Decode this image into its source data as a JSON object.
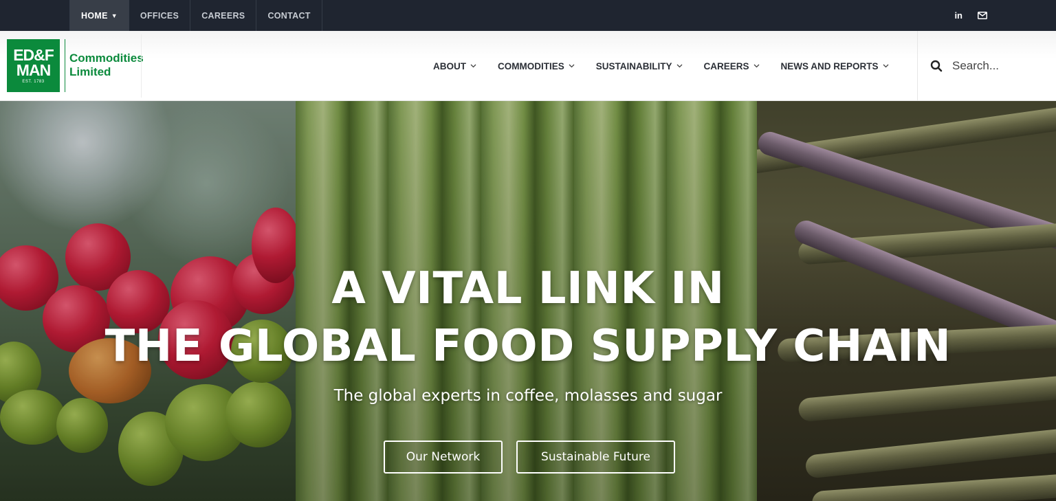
{
  "topbar": {
    "nav": [
      {
        "label": "HOME",
        "active": true,
        "has_dropdown": true
      },
      {
        "label": "OFFICES",
        "active": false
      },
      {
        "label": "CAREERS",
        "active": false
      },
      {
        "label": "CONTACT",
        "active": false
      }
    ],
    "icons": [
      "linkedin-icon",
      "email-icon"
    ],
    "linkedin_glyph": "in",
    "email_glyph": "✉"
  },
  "logo": {
    "line1": "ED&F",
    "line2": "MAN",
    "est": "EST. 1783",
    "name_line1": "Commodities",
    "name_line2": "Limited",
    "brand_color": "#0b8a3c"
  },
  "mainnav": {
    "items": [
      {
        "label": "ABOUT"
      },
      {
        "label": "COMMODITIES"
      },
      {
        "label": "SUSTAINABILITY"
      },
      {
        "label": "CAREERS"
      },
      {
        "label": "NEWS AND REPORTS"
      }
    ],
    "chevron": "⌄"
  },
  "search": {
    "placeholder": "Search..."
  },
  "hero": {
    "title_line1": "A VITAL LINK IN",
    "title_line2": "THE GLOBAL FOOD SUPPLY CHAIN",
    "subtitle": "The global experts in coffee, molasses and sugar",
    "buttons": [
      {
        "label": "Our Network"
      },
      {
        "label": "Sustainable Future"
      }
    ]
  }
}
